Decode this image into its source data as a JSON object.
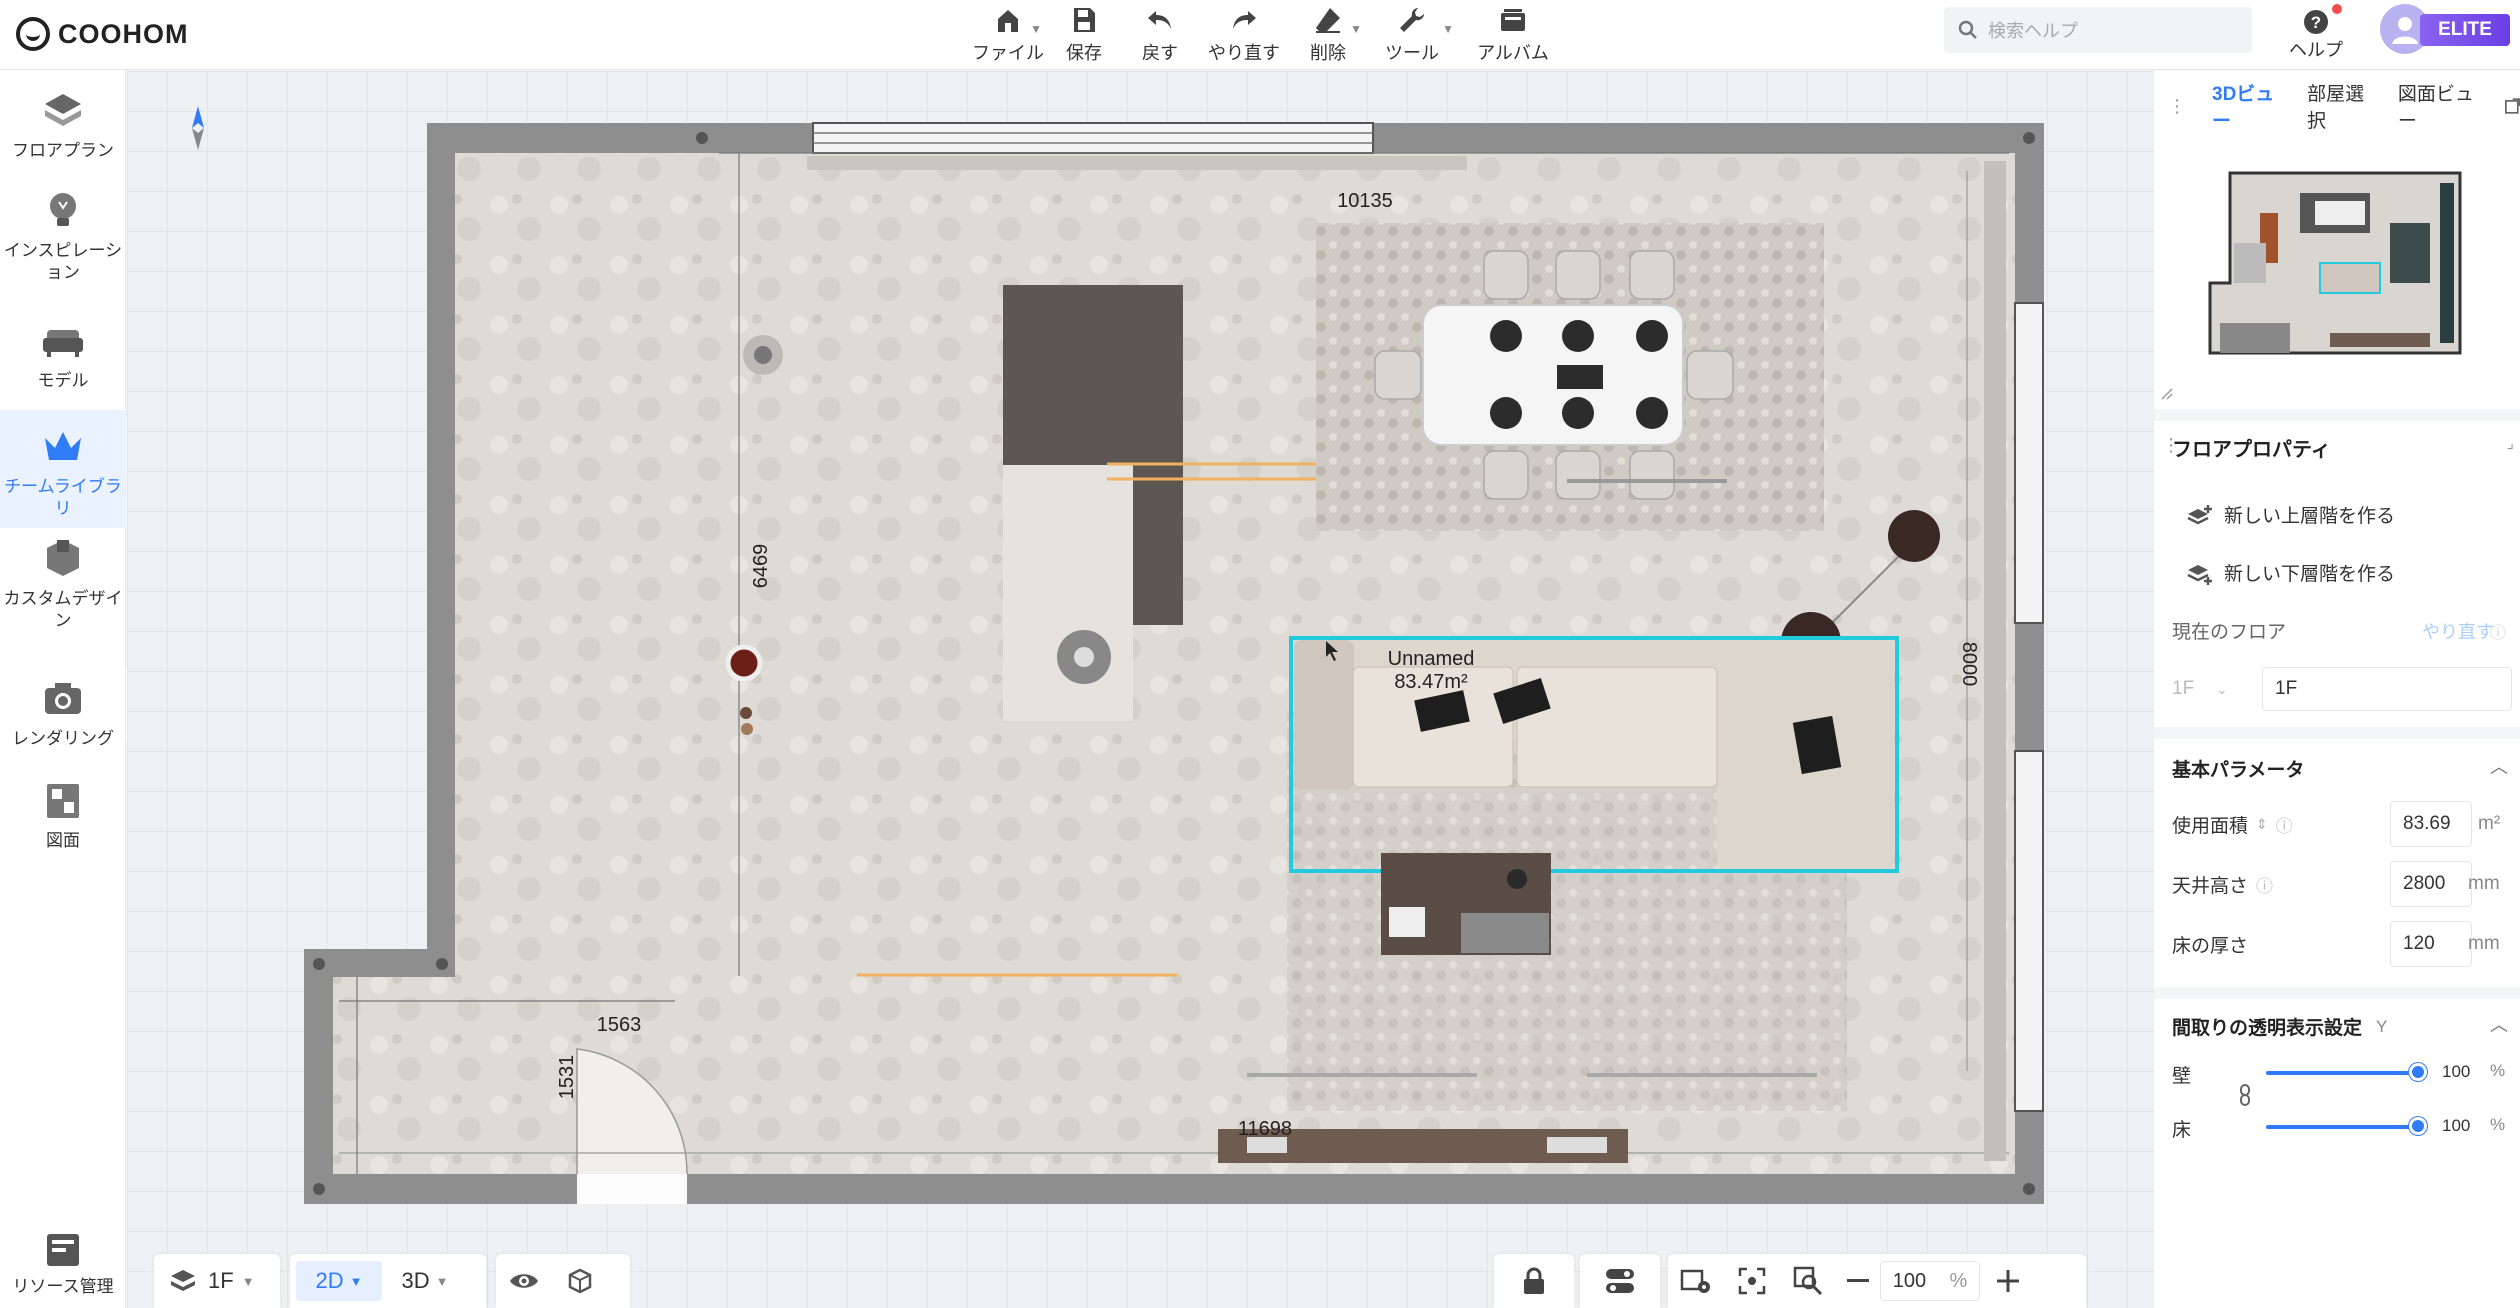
{
  "app": {
    "brand": "COOHOM"
  },
  "toolbar": {
    "file": "ファイル",
    "save": "保存",
    "undo": "戻す",
    "redo": "やり直す",
    "delete": "削除",
    "tools": "ツール",
    "album": "アルバム"
  },
  "search": {
    "placeholder": "検索ヘルプ"
  },
  "help": {
    "label": "ヘルプ"
  },
  "account": {
    "badge": "ELITE"
  },
  "sidebar": {
    "items": [
      {
        "label": "フロアプラン",
        "icon": "floorplan-icon"
      },
      {
        "label": "インスピレーション",
        "icon": "lightbulb-icon"
      },
      {
        "label": "モデル",
        "icon": "sofa-icon"
      },
      {
        "label": "チームライブラリ",
        "icon": "crown-icon"
      },
      {
        "label": "カスタムデザイン",
        "icon": "custom-design-icon"
      },
      {
        "label": "レンダリング",
        "icon": "camera-icon"
      },
      {
        "label": "図面",
        "icon": "drawing-icon"
      }
    ],
    "resource": "リソース管理"
  },
  "plan": {
    "room_name": "Unnamed",
    "room_area": "83.47m²",
    "dims": {
      "top": "10135",
      "left": "6469",
      "right": "8000",
      "bottom": "11698",
      "small_h": "1563",
      "small_v": "1531"
    }
  },
  "bottombar": {
    "floor": "1F",
    "mode_2d": "2D",
    "mode_3d": "3D",
    "zoom": "100",
    "zoom_unit": "%"
  },
  "viewpanel": {
    "tabs": [
      "3Dビュー",
      "部屋選択",
      "図面ビュー"
    ],
    "active_tab": 0
  },
  "floorprops": {
    "title": "フロアプロパティ",
    "new_upper": "新しい上層階を作る",
    "new_lower": "新しい下層階を作る",
    "current_floor_label": "現在のフロア",
    "current_floor_action": "やり直す",
    "floor_code": "1F",
    "floor_name": "1F",
    "basic_title": "基本パラメータ",
    "usable_area_label": "使用面積",
    "usable_area": "83.69",
    "usable_area_unit": "m²",
    "ceiling_label": "天井高さ",
    "ceiling": "2800",
    "ceiling_unit": "mm",
    "floor_thick_label": "床の厚さ",
    "floor_thick": "120",
    "floor_thick_unit": "mm",
    "transparency_title": "間取りの透明表示設定",
    "transparency_key": "Y",
    "wall_label": "壁",
    "wall_value": "100",
    "wall_level": 1.0,
    "floor_label": "床",
    "floor_value": "100",
    "floor_level": 1.0,
    "pct": "%"
  }
}
